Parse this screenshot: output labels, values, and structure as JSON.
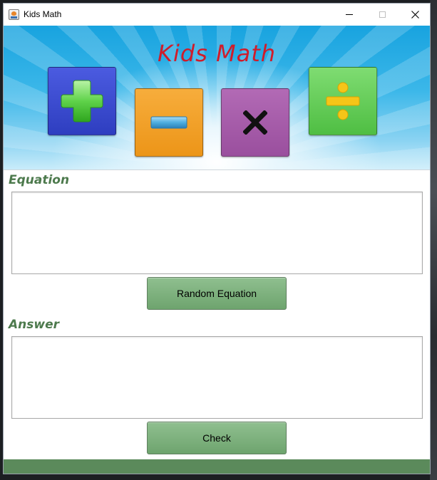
{
  "window": {
    "title": "Kids Math",
    "icon": "java-cup-icon",
    "controls": [
      "minimize-icon",
      "maximize-icon",
      "close-icon"
    ]
  },
  "banner": {
    "title": "Kids Math",
    "operations": [
      {
        "name": "addition",
        "icon": "plus-icon",
        "color": "#3a4ad0"
      },
      {
        "name": "subtraction",
        "icon": "minus-icon",
        "color": "#f2a02a"
      },
      {
        "name": "multiplication",
        "icon": "times-icon",
        "color": "#a65aaa"
      },
      {
        "name": "division",
        "icon": "divide-icon",
        "color": "#62c956"
      }
    ]
  },
  "equation": {
    "label": "Equation",
    "value": ""
  },
  "buttons": {
    "random_label": "Random Equation",
    "check_label": "Check"
  },
  "answer": {
    "label": "Answer",
    "value": ""
  },
  "colors": {
    "label_green": "#4d7a4d",
    "button_green": "#7fb07f",
    "footer_green": "#5b8a5b",
    "title_red": "#d01c2a"
  }
}
